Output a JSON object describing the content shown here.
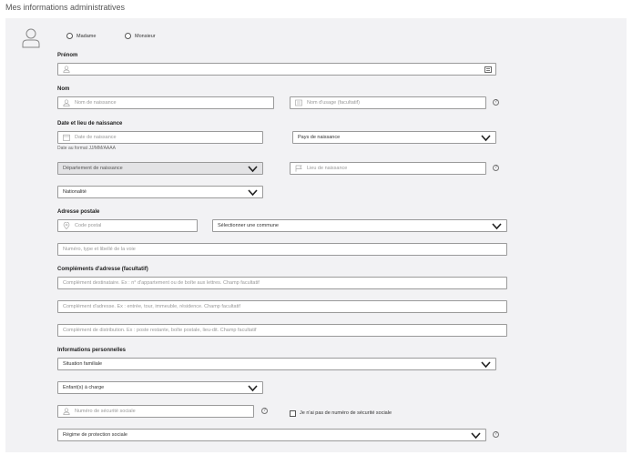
{
  "page": {
    "title": "Mes informations administratives"
  },
  "civility": {
    "madame": "Madame",
    "monsieur": "Monsieur"
  },
  "labels": {
    "prenom": "Prénom",
    "nom": "Nom",
    "birth": "Date et lieu de naissance",
    "address": "Adresse postale",
    "address_complements": "Compléments d'adresse (facultatif)",
    "personal_info": "Informations personnelles"
  },
  "hints": {
    "date_format": "Date au format JJ/MM/AAAA"
  },
  "fields": {
    "nom_naissance": "Nom de naissance",
    "nom_usage": "Nom d'usage (facultatif)",
    "date_naissance": "Date de naissance",
    "pays_naissance": "Pays de naissance",
    "departement_naissance": "Département de naissance",
    "lieu_naissance": "Lieu de naissance",
    "nationalite": "Nationalité",
    "code_postal": "Code postal",
    "commune": "Sélectionner une commune",
    "voie": "Numéro, type et libellé de la voie",
    "complement_destinataire": "Complément destinataire. Ex : n° d'appartement ou de boîte aux lettres. Champ facultatif",
    "complement_adresse": "Complément d'adresse. Ex : entrée, tour, immeuble, résidence. Champ facultatif",
    "complement_distribution": "Complément de distribution. Ex : poste restante, boîte postale, lieu-dit. Champ facultatif",
    "situation_familiale": "Situation familiale",
    "enfants": "Enfant(s) à charge",
    "securite_sociale": "Numéro de sécurité sociale",
    "no_secu_checkbox": "Je n'ai pas de numéro de sécurité sociale",
    "regime_protection": "Régime de protection sociale"
  },
  "icons": {
    "help": "?"
  }
}
